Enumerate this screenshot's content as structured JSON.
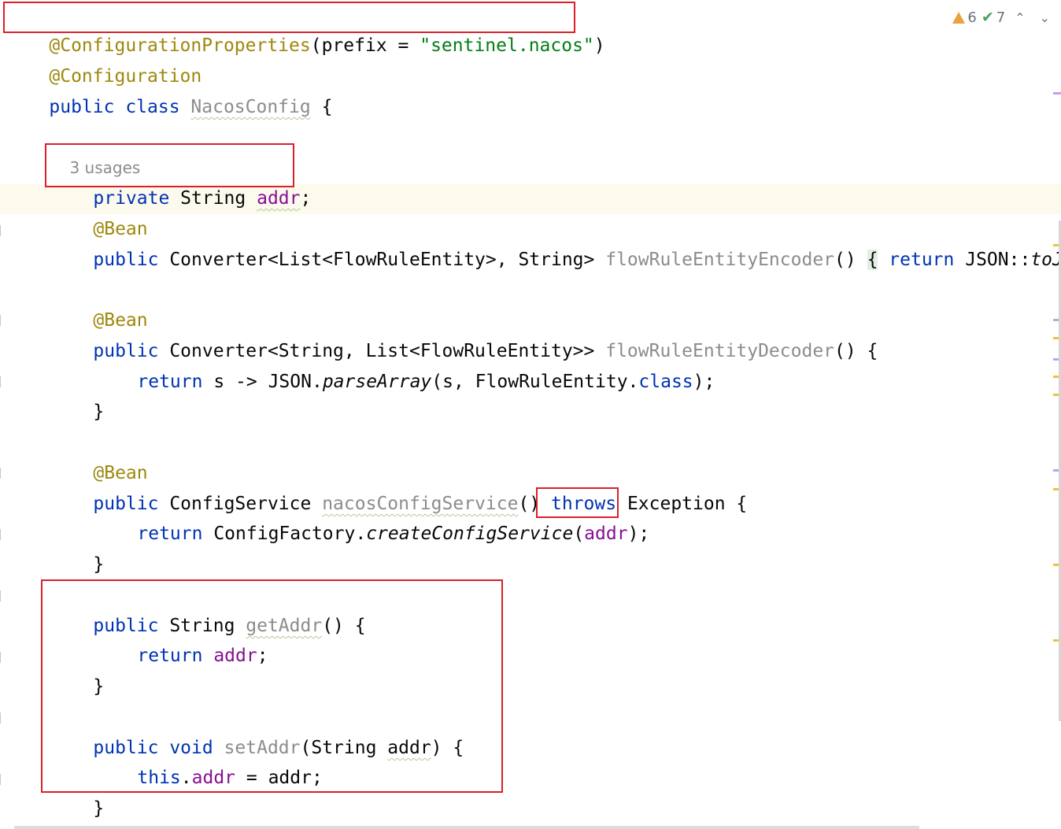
{
  "editor": {
    "code": {
      "l1": {
        "ann": "@ConfigurationProperties",
        "open": "(prefix = ",
        "str": "\"sentinel.nacos\"",
        "close": ")"
      },
      "l2": {
        "ann": "@Configuration"
      },
      "l3": {
        "kw": "public class ",
        "name": "NacosConfig",
        "rest": " {"
      },
      "usages_hint": "3 usages",
      "l5": {
        "kw": "private ",
        "type": "String ",
        "field": "addr",
        "rest": ";"
      },
      "l6": {
        "ann": "@Bean"
      },
      "l7": {
        "kw": "public ",
        "type": "Converter<List<FlowRuleEntity>, String> ",
        "method": "flowRuleEntityEncoder",
        "paren": "() ",
        "brace": "{",
        "sp": " ",
        "kw2": "return ",
        "rest": "JSON::",
        "ital": "toJSONString",
        "end": "; }"
      },
      "l8": {
        "ann": "@Bean"
      },
      "l9": {
        "kw": "public ",
        "type": "Converter<String, List<FlowRuleEntity>> ",
        "method": "flowRuleEntityDecoder",
        "rest": "() {"
      },
      "l10": {
        "kw": "return ",
        "pre": "s -> JSON.",
        "ital": "parseArray",
        "mid": "(s, FlowRuleEntity.",
        "kw2": "class",
        "end": ");"
      },
      "l11": {
        "brace": "}"
      },
      "l12": {
        "ann": "@Bean"
      },
      "l13": {
        "kw": "public ",
        "type": "ConfigService ",
        "method": "nacosConfigService",
        "paren": "() ",
        "kw2": "throws ",
        "rest": "Exception {"
      },
      "l14": {
        "kw": "return ",
        "pre": "ConfigFactory.",
        "ital": "createConfigService",
        "open": "(",
        "field": "addr",
        "end": ");"
      },
      "l15": {
        "brace": "}"
      },
      "l16": {
        "kw": "public ",
        "type": "String ",
        "method": "getAddr",
        "rest": "() {"
      },
      "l17": {
        "kw": "return ",
        "field": "addr",
        "end": ";"
      },
      "l18": {
        "brace": "}"
      },
      "l19": {
        "kw": "public void ",
        "method": "setAddr",
        "open": "(String ",
        "param": "addr",
        "rest": ") {"
      },
      "l20": {
        "kw": "this",
        "dot": ".",
        "field": "addr",
        "rest": " = addr;"
      },
      "l21": {
        "brace": "}"
      },
      "l22": {
        "brace": "}"
      }
    },
    "inspection": {
      "warnings": "6",
      "weak_warnings": "7",
      "warning_color": "#e8a33d",
      "ok_color": "#4aa163"
    },
    "colors": {
      "keyword": "#0033b3",
      "annotation": "#9e880d",
      "string": "#067d17",
      "field": "#871094",
      "unused": "#8c8c8c",
      "highlight_box": "#d9202b",
      "caret_line": "#fcfaed"
    }
  }
}
